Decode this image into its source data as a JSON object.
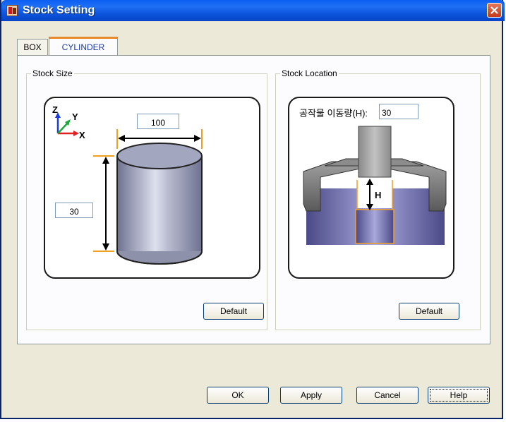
{
  "window": {
    "title": "Stock Setting"
  },
  "tabs": [
    {
      "label": "BOX",
      "active": false
    },
    {
      "label": "CYLINDER",
      "active": true
    }
  ],
  "stock_size": {
    "group_label": "Stock Size",
    "diameter_value": "100",
    "height_value": "30",
    "axis_labels": {
      "z": "Z",
      "y": "Y",
      "x": "X"
    },
    "default_label": "Default"
  },
  "stock_location": {
    "group_label": "Stock Location",
    "offset_label": "공작물 이동량(H):",
    "offset_value": "30",
    "h_marker": "H",
    "default_label": "Default"
  },
  "footer": {
    "ok_label": "OK",
    "apply_label": "Apply",
    "cancel_label": "Cancel",
    "help_label": "Help"
  },
  "colors": {
    "titlebar": "#0a5ef2",
    "dimension_marker": "#f0a020",
    "chuck": "#7a78b8"
  },
  "icons": [
    "app-icon",
    "close-icon",
    "axis-triad-icon"
  ]
}
